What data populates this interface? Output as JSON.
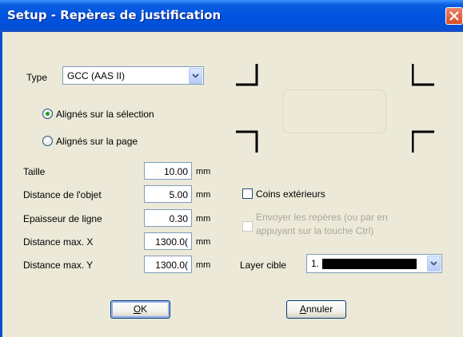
{
  "window": {
    "title": "Setup - Repères de justification"
  },
  "type": {
    "label": "Type",
    "selected": "GCC (AAS II)"
  },
  "alignment": {
    "options": [
      {
        "label": "Alignés sur la sélection",
        "checked": true
      },
      {
        "label": "Alignés sur la page",
        "checked": false
      }
    ]
  },
  "fields": [
    {
      "label": "Taille",
      "value": "10.00",
      "unit": "mm"
    },
    {
      "label": "Distance de l'objet",
      "value": "5.00",
      "unit": "mm"
    },
    {
      "label": "Epaisseur de ligne",
      "value": "0.30",
      "unit": "mm"
    },
    {
      "label": "Distance max. X",
      "value": "1300.0(",
      "unit": "mm"
    },
    {
      "label": "Distance max. Y",
      "value": "1300.0(",
      "unit": "mm"
    }
  ],
  "options": {
    "outer_corners": {
      "label": "Coins extérieurs",
      "checked": false,
      "enabled": true
    },
    "send_marks": {
      "label_line1": "Envoyer les repères (ou par en",
      "label_line2": "appuyant sur la touche Ctrl)",
      "checked": false,
      "enabled": false
    }
  },
  "layer": {
    "label": "Layer cible",
    "selected": "1.",
    "swatch_color": "#000000"
  },
  "buttons": {
    "ok": "OK",
    "ok_mnemonic": "O",
    "ok_rest": "K",
    "cancel": "Annuler",
    "cancel_mnemonic": "A",
    "cancel_rest": "nnuler"
  },
  "icons": {
    "close": "close-icon",
    "dropdown": "chevron-down-icon"
  },
  "colors": {
    "titlebar": "#0050D8",
    "dialog_bg": "#ECE9D8",
    "close_button": "#D64E22",
    "radio_dot": "#21A121"
  }
}
